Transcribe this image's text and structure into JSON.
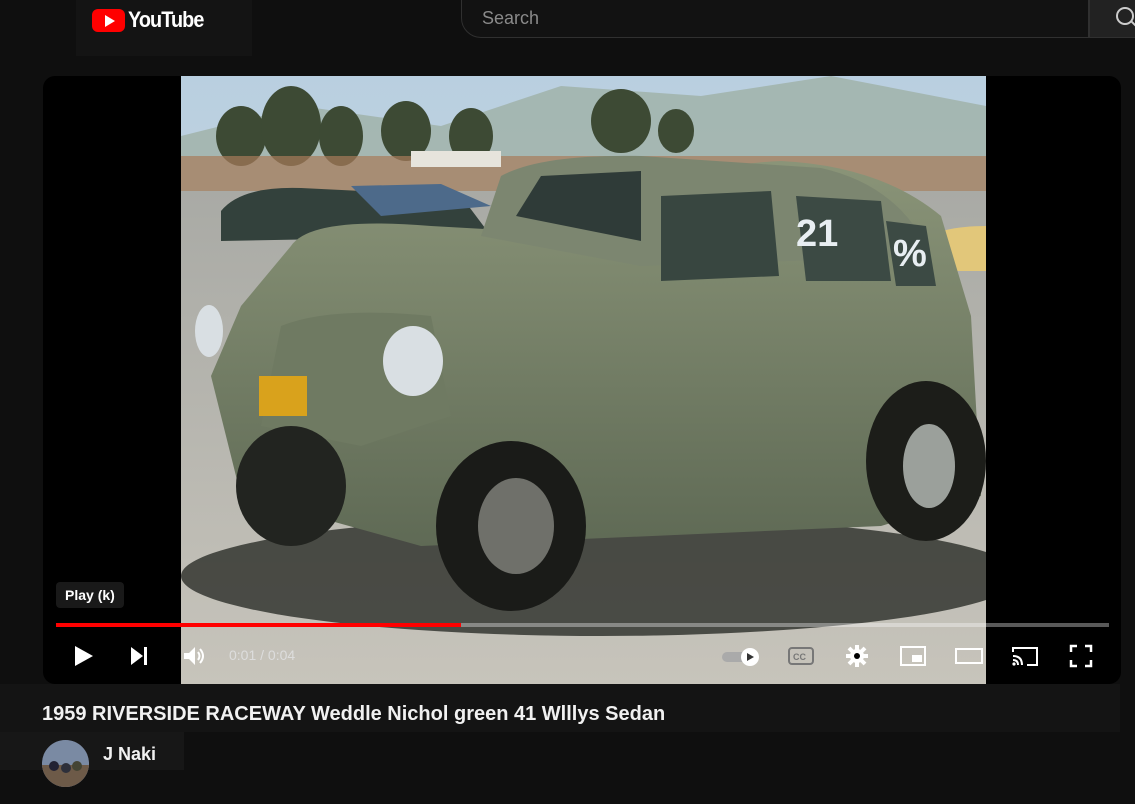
{
  "header": {
    "logo_text": "YouTube",
    "search_placeholder": "Search"
  },
  "player": {
    "tooltip": "Play (k)",
    "current_time": "0:01",
    "duration": "0:04",
    "time_separator": " / ",
    "progress_fraction": 0.385,
    "progress_color": "#ff0000",
    "icons": [
      "play-icon",
      "next-icon",
      "volume-icon",
      "autoplay-toggle-icon",
      "captions-icon",
      "settings-icon",
      "miniplayer-icon",
      "theater-icon",
      "cast-icon",
      "fullscreen-icon"
    ]
  },
  "video": {
    "title": "1959 RIVERSIDE RACEWAY Weddle Nichol green 41 Wlllys Sedan"
  },
  "channel": {
    "name": "J Naki"
  }
}
